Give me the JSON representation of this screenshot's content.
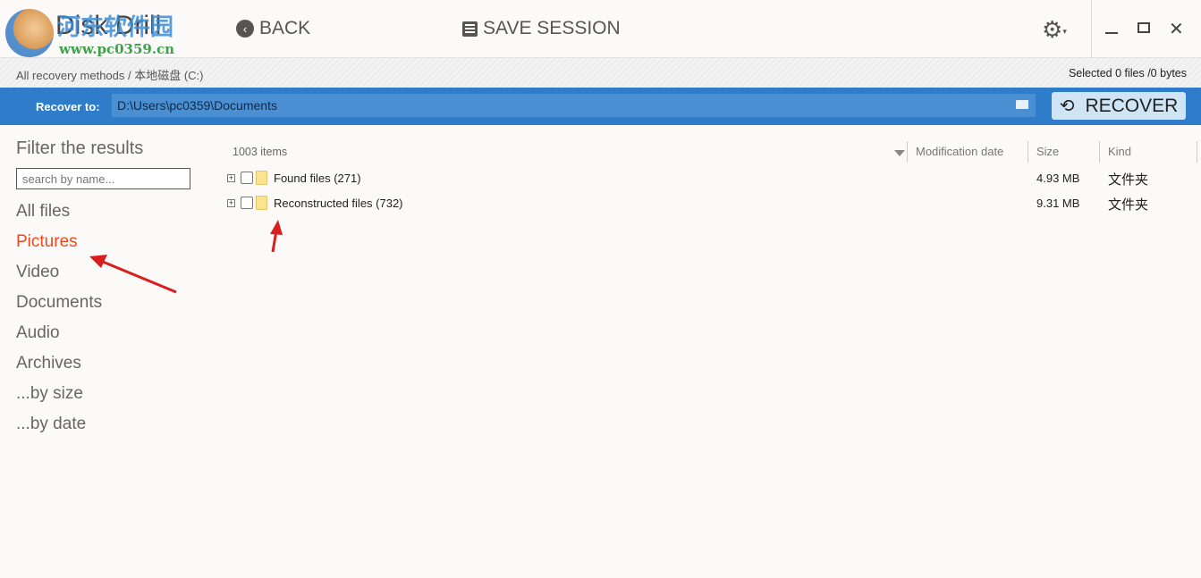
{
  "app": {
    "title": "Disk Drill",
    "watermark_text": "河东软件园",
    "watermark_url": "www.pc0359.cn"
  },
  "toolbar": {
    "back": "BACK",
    "save_session": "SAVE SESSION",
    "settings_icon": "gear-icon"
  },
  "breadcrumb": {
    "path": "All recovery methods / 本地磁盘 (C:)",
    "selected": "Selected 0 files /0 bytes"
  },
  "recover_bar": {
    "label": "Recover to:",
    "path": "D:\\Users\\pc0359\\Documents",
    "button": "RECOVER",
    "accent": "#2f7ccb"
  },
  "sidebar": {
    "title": "Filter the results",
    "search_placeholder": "search by name...",
    "items": [
      {
        "label": "All files"
      },
      {
        "label": "Pictures",
        "active": true
      },
      {
        "label": "Video"
      },
      {
        "label": "Documents"
      },
      {
        "label": "Audio"
      },
      {
        "label": "Archives"
      },
      {
        "label": "...by size"
      },
      {
        "label": "...by date"
      }
    ]
  },
  "list": {
    "count": "1003 items",
    "columns": {
      "date": "Modification date",
      "size": "Size",
      "kind": "Kind"
    },
    "rows": [
      {
        "name": "Found files (271)",
        "size": "4.93 MB",
        "kind": "文件夹"
      },
      {
        "name": "Reconstructed files (732)",
        "size": "9.31 MB",
        "kind": "文件夹"
      }
    ]
  }
}
